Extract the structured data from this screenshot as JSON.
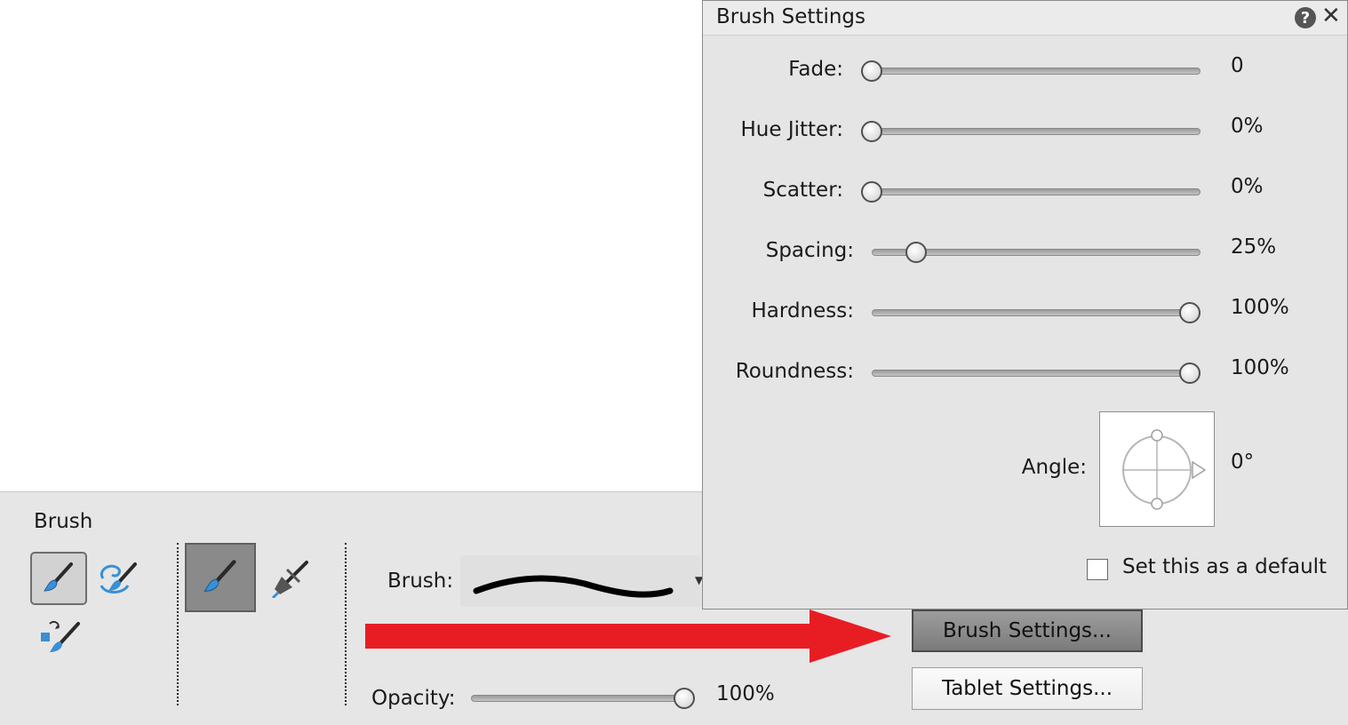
{
  "options_bar": {
    "tool_name": "Brush",
    "tools": [
      {
        "icon": "brush-icon",
        "selected": true
      },
      {
        "icon": "impressionist-brush-icon",
        "selected": false
      },
      {
        "icon": "color-replacement-brush-icon",
        "selected": false
      }
    ],
    "modes": [
      {
        "icon": "brush-mode-icon",
        "selected": true
      },
      {
        "icon": "airbrush-icon",
        "selected": false
      }
    ],
    "brush_label": "Brush:",
    "opacity_label": "Opacity:",
    "opacity_value": "100%",
    "opacity_level": 1.0,
    "brush_settings_button": "Brush Settings...",
    "tablet_settings_button": "Tablet Settings..."
  },
  "panel": {
    "title": "Brush Settings",
    "rows": [
      {
        "label": "Fade:",
        "value": "0",
        "level": 0.0
      },
      {
        "label": "Hue Jitter:",
        "value": "0%",
        "level": 0.0
      },
      {
        "label": "Scatter:",
        "value": "0%",
        "level": 0.0
      },
      {
        "label": "Spacing:",
        "value": "25%",
        "level": 0.11
      },
      {
        "label": "Hardness:",
        "value": "100%",
        "level": 1.0
      },
      {
        "label": "Roundness:",
        "value": "100%",
        "level": 1.0
      }
    ],
    "angle_label": "Angle:",
    "angle_value": "0°",
    "default_checkbox_label": "Set this as a default",
    "default_checked": false
  },
  "colors": {
    "annotation_arrow": "#e81d24",
    "panel_background": "#e5e5e5",
    "options_background": "#e6e6e6",
    "brush_icon_blue": "#3a8fd6"
  }
}
